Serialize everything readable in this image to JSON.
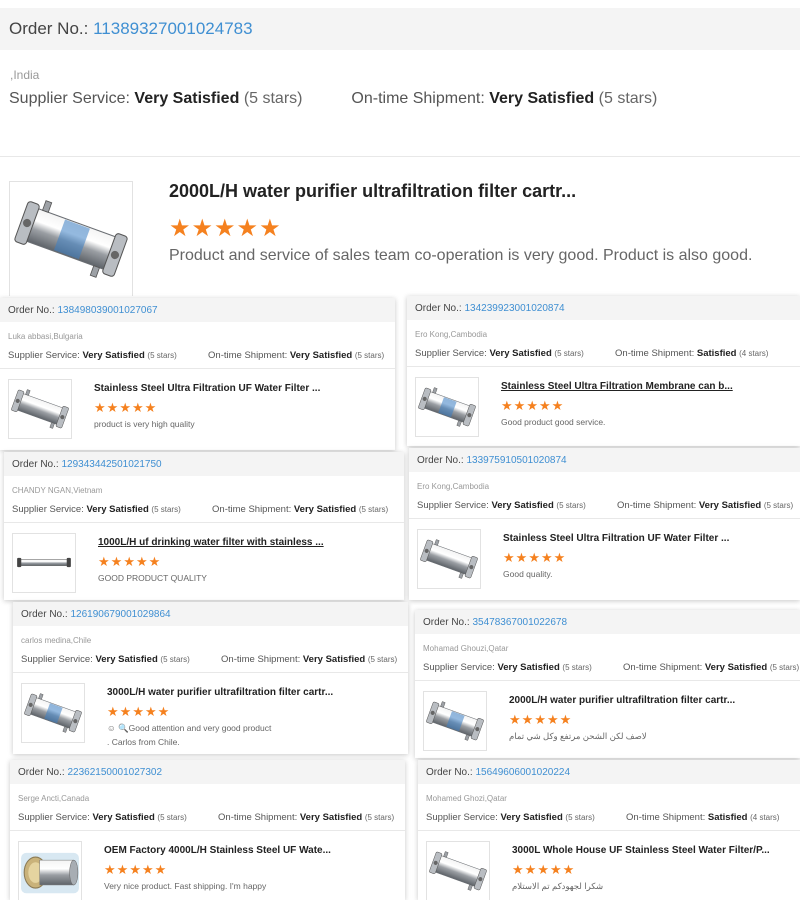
{
  "labels": {
    "order_no": "Order No.:",
    "supplier_service": "Supplier Service:",
    "ontime_shipment": "On-time Shipment:"
  },
  "reviews": [
    {
      "order_no": "11389327001024783",
      "buyer": ",India",
      "supplier_rating": "Very Satisfied",
      "supplier_stars": "(5 stars)",
      "shipment_rating": "Very Satisfied",
      "shipment_stars": "(5 stars)",
      "product_title": "2000L/H water purifier ultrafiltration filter cartr...",
      "rating_stars": 5,
      "review_text": "Product and service of sales team co-operation is very good.   Product is also good.",
      "image_icon": "uf-filter-housing-blue-label-icon"
    },
    {
      "order_no": "138498039001027067",
      "buyer": "Luka abbasi,Bulgaria",
      "supplier_rating": "Very Satisfied",
      "supplier_stars": "(5 stars)",
      "shipment_rating": "Very Satisfied",
      "shipment_stars": "(5 stars)",
      "product_title": "Stainless Steel Ultra Filtration UF Water Filter ...",
      "rating_stars": 5,
      "review_text": "product is very high quality",
      "image_icon": "uf-filter-housing-icon"
    },
    {
      "order_no": "134239923001020874",
      "buyer": "Ero Kong,Cambodia",
      "supplier_rating": "Very Satisfied",
      "supplier_stars": "(5 stars)",
      "shipment_rating": "Satisfied",
      "shipment_stars": "(4 stars)",
      "product_title": "Stainless Steel Ultra Filtration Membrane can b...",
      "rating_stars": 5,
      "review_text": "Good product good service.",
      "image_icon": "uf-filter-housing-blue-label-icon"
    },
    {
      "order_no": "129343442501021750",
      "buyer": "CHANDY NGAN,Vietnam",
      "supplier_rating": "Very Satisfied",
      "supplier_stars": "(5 stars)",
      "shipment_rating": "Very Satisfied",
      "shipment_stars": "(5 stars)",
      "product_title": "1000L/H uf drinking water filter with stainless ...",
      "rating_stars": 5,
      "review_text": "GOOD PRODUCT QUALITY",
      "image_icon": "long-filter-tube-icon"
    },
    {
      "order_no": "133975910501020874",
      "buyer": "Ero Kong,Cambodia",
      "supplier_rating": "Very Satisfied",
      "supplier_stars": "(5 stars)",
      "shipment_rating": "Very Satisfied",
      "shipment_stars": "(5 stars)",
      "product_title": "Stainless Steel Ultra Filtration UF Water Filter ...",
      "rating_stars": 5,
      "review_text": "Good quality.",
      "image_icon": "uf-filter-housing-icon"
    },
    {
      "order_no": "126190679001029864",
      "buyer": "carlos medina,Chile",
      "supplier_rating": "Very Satisfied",
      "supplier_stars": "(5 stars)",
      "shipment_rating": "Very Satisfied",
      "shipment_stars": "(5 stars)",
      "product_title": "3000L/H water purifier ultrafiltration filter cartr...",
      "rating_stars": 5,
      "review_text": "☺ 🔍Good attention and very good product",
      "review_text_2": ". Carlos from Chile.",
      "image_icon": "uf-filter-housing-blue-label-icon"
    },
    {
      "order_no": "35478367001022678",
      "buyer": "Mohamad Ghouzi,Qatar",
      "supplier_rating": "Very Satisfied",
      "supplier_stars": "(5 stars)",
      "shipment_rating": "Very Satisfied",
      "shipment_stars": "(5 stars)",
      "product_title": "2000L/H water purifier ultrafiltration filter cartr...",
      "rating_stars": 5,
      "review_text": "لاصف لكن الشحن مرتفع وكل شي تمام",
      "review_rtl": true,
      "image_icon": "uf-filter-housing-blue-label-icon"
    },
    {
      "order_no": "22362150001027302",
      "buyer": "Serge Ancti,Canada",
      "supplier_rating": "Very Satisfied",
      "supplier_stars": "(5 stars)",
      "shipment_rating": "Very Satisfied",
      "shipment_stars": "(5 stars)",
      "product_title": "OEM Factory 4000L/H Stainless Steel UF Wate...",
      "rating_stars": 5,
      "review_text": "Very nice product. Fast shipping. I'm happy",
      "image_icon": "large-membrane-vessel-icon"
    },
    {
      "order_no": "15649606001020224",
      "buyer": "Mohamed Ghozi,Qatar",
      "supplier_rating": "Very Satisfied",
      "supplier_stars": "(5 stars)",
      "shipment_rating": "Satisfied",
      "shipment_stars": "(4 stars)",
      "product_title": "3000L Whole House UF Stainless Steel Water Filter/P...",
      "rating_stars": 5,
      "review_text": "شكرا لجهودكم تم الاستلام",
      "review_rtl": true,
      "image_icon": "uf-filter-housing-icon"
    }
  ],
  "colors": {
    "order_link": "#3f8fd2",
    "star": "#f5811f",
    "order_bar_bg": "#f4f4f4",
    "filter_label": "#3d7fc4"
  }
}
